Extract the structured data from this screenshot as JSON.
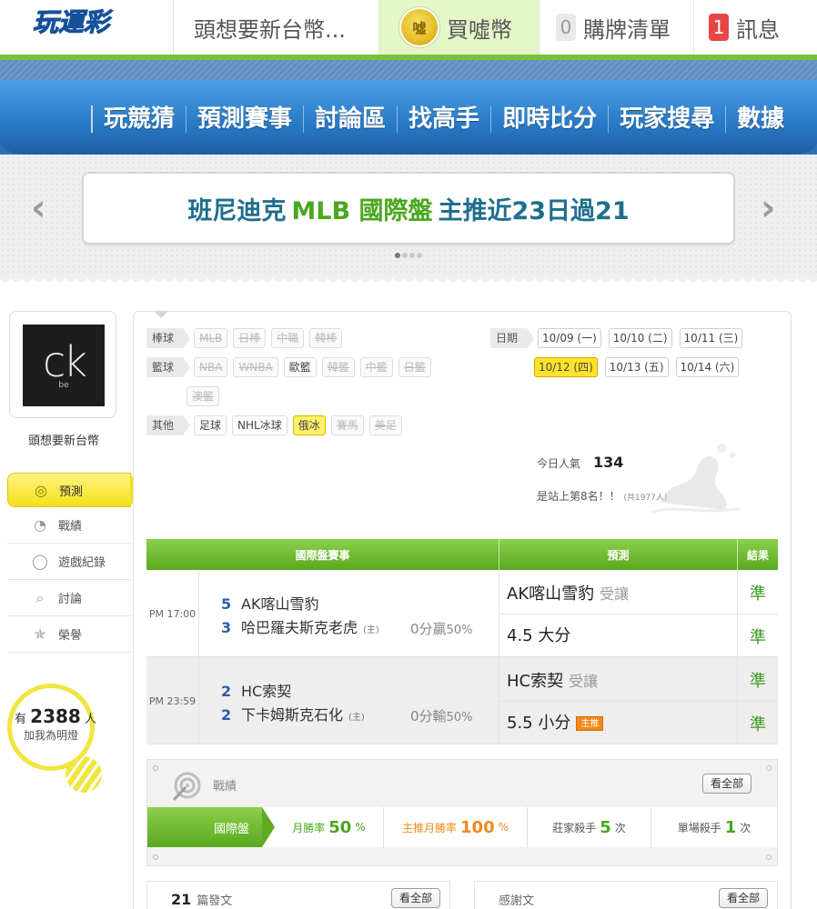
{
  "topbar": {
    "logo_text": "玩運彩",
    "user_label": "頭想要新台幣...",
    "coin_icon_text": "噓",
    "buy_label": "買噓幣",
    "cart_count": "0",
    "cart_label": "購牌清單",
    "msg_count": "1",
    "msg_label": "訊息"
  },
  "nav": [
    "玩競猜",
    "預測賽事",
    "討論區",
    "找高手",
    "即時比分",
    "玩家搜尋",
    "數據"
  ],
  "banner": {
    "prev": "‹",
    "next": "›",
    "headline_a": "班尼迪克",
    "headline_b": "MLB 國際盤",
    "headline_c": "主推近23日過21",
    "slides": 4,
    "active_slide": 1
  },
  "profile": {
    "avatar_text": "ck",
    "avatar_sub": "be",
    "name": "頭想要新台幣"
  },
  "sidemenu": [
    {
      "label": "預測",
      "icon": "target-icon",
      "active": true
    },
    {
      "label": "戰績",
      "icon": "chart-icon",
      "active": false
    },
    {
      "label": "遊戲紀錄",
      "icon": "record-icon",
      "active": false
    },
    {
      "label": "討論",
      "icon": "search-chat-icon",
      "active": false
    },
    {
      "label": "榮譽",
      "icon": "medal-icon",
      "active": false
    }
  ],
  "lamp": {
    "prefix": "有",
    "count": "2388",
    "suffix": "人",
    "line2": "加我為明燈"
  },
  "filters": {
    "baseball": {
      "label": "棒球",
      "chips": [
        "MLB",
        "日棒",
        "中職",
        "韓棒"
      ]
    },
    "basketball": {
      "label": "籃球",
      "chips": [
        "NBA",
        "WNBA",
        "歐籃",
        "韓籃",
        "中籃",
        "日籃",
        "澳籃"
      ]
    },
    "other": {
      "label": "其他",
      "chips": [
        "足球",
        "NHL冰球",
        "俄冰",
        "賽馬",
        "美足"
      ]
    }
  },
  "dates": {
    "label": "日期",
    "row1": [
      "10/09 (一)",
      "10/10 (二)",
      "10/11 (三)"
    ],
    "row2": [
      "10/12 (四)",
      "10/13 (五)",
      "10/14 (六)"
    ]
  },
  "popularity": {
    "label": "今日人氣",
    "value": "134",
    "rank_text": "是站上第8名！！",
    "rank_total": "(共1977人)"
  },
  "table": {
    "headers": [
      "國際盤賽事",
      "預測",
      "結果"
    ],
    "rows": [
      {
        "time": "PM 17:00",
        "team1_score": "5",
        "team1": "AK喀山雪豹",
        "team2_score": "3",
        "team2": "哈巴羅夫斯克老虎",
        "team2_tag": "(主)",
        "odds": "0分贏",
        "odds_pct": "50%",
        "pred1": "AK喀山雪豹",
        "pred1_tag": "受讓",
        "pred2": "4.5 大分",
        "pred2_badge": "",
        "res1": "準",
        "res2": "準"
      },
      {
        "time": "PM 23:59",
        "team1_score": "2",
        "team1": "HC索契",
        "team2_score": "2",
        "team2": "下卡姆斯克石化",
        "team2_tag": "(主)",
        "odds": "0分輸",
        "odds_pct": "50%",
        "pred1": "HC索契",
        "pred1_tag": "受讓",
        "pred2": "5.5 小分",
        "pred2_badge": "主推",
        "res1": "準",
        "res2": "準"
      }
    ]
  },
  "stats": {
    "title": "戰績",
    "view_all": "看全部",
    "tab": "國際盤",
    "monthly_label": "月勝率",
    "monthly_value": "50",
    "monthly_unit": "%",
    "main_label": "主推月勝率",
    "main_value": "100",
    "main_unit": "%",
    "banker_label": "莊家殺手",
    "banker_value": "5",
    "banker_unit": "次",
    "single_label": "單場殺手",
    "single_value": "1",
    "single_unit": "次"
  },
  "bottom": {
    "posts_count": "21",
    "posts_label": "篇發文",
    "posts_btn": "看全部",
    "thanks_label": "感謝文",
    "thanks_btn": "看全部"
  },
  "colors": {
    "green": "#5aa91f",
    "blue": "#2b7cc7",
    "yellow": "#f6df19",
    "orange": "#f08a1c"
  }
}
